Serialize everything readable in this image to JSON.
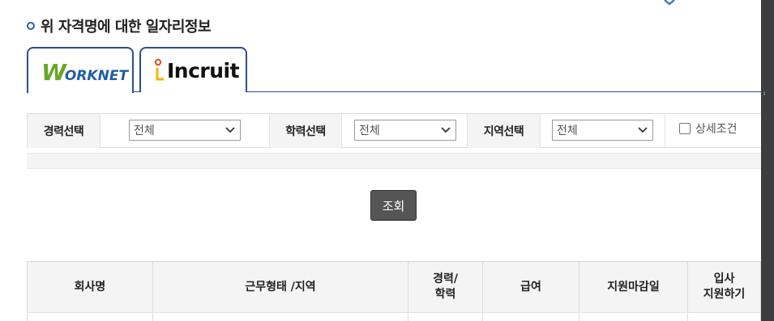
{
  "section": {
    "title": "위 자격명에 대한 일자리정보"
  },
  "tabs": [
    {
      "name": "worknet",
      "logo_big": "W",
      "logo_rest": "ORKNET",
      "logo_colors": [
        "#6aa629",
        "#1f5ea8"
      ]
    },
    {
      "name": "incruit",
      "logo_text": "Incruit",
      "logo_colors": [
        "#e94e1b",
        "#f5b400"
      ]
    }
  ],
  "filters": {
    "career_label": "경력선택",
    "career_value": "전체",
    "education_label": "학력선택",
    "education_value": "전체",
    "region_label": "지역선택",
    "region_value": "전체",
    "detail_label": "상세조건"
  },
  "search_button": "조회",
  "table": {
    "headers": [
      "회사명",
      "근무형태 /지역",
      "경력/\n학력",
      "급여",
      "지원마감일",
      "입사\n지원하기"
    ]
  },
  "colors": {
    "accent": "#2b4f8c",
    "button": "#555555",
    "header_bg": "#f4f4f4"
  }
}
